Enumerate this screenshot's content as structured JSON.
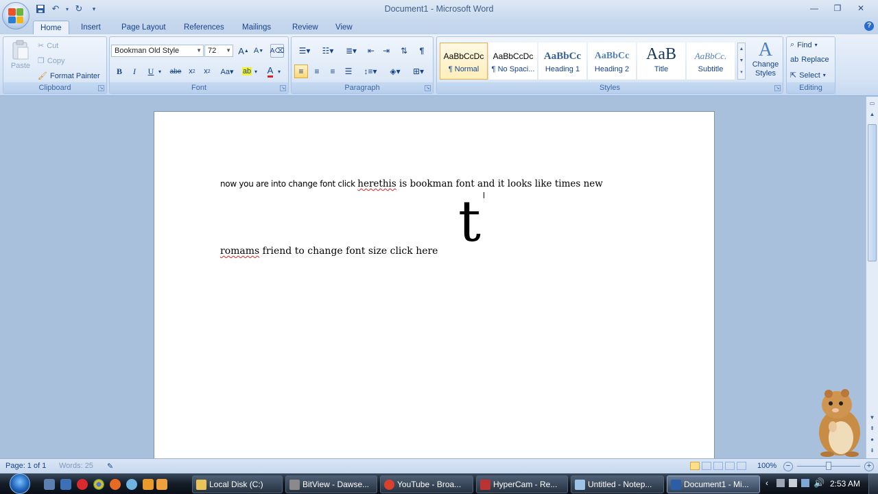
{
  "window": {
    "title": "Document1 - Microsoft Word"
  },
  "tabs": [
    "Home",
    "Insert",
    "Page Layout",
    "References",
    "Mailings",
    "Review",
    "View"
  ],
  "clipboard": {
    "label": "Clipboard",
    "paste": "Paste",
    "cut": "Cut",
    "copy": "Copy",
    "format_painter": "Format Painter"
  },
  "font": {
    "label": "Font",
    "name": "Bookman Old Style",
    "size": "72"
  },
  "paragraph": {
    "label": "Paragraph"
  },
  "styles": {
    "label": "Styles",
    "items": [
      {
        "sample": "AaBbCcDc",
        "name": "¶ Normal"
      },
      {
        "sample": "AaBbCcDc",
        "name": "¶ No Spaci..."
      },
      {
        "sample": "AaBbCс",
        "name": "Heading 1"
      },
      {
        "sample": "AaBbCc",
        "name": "Heading 2"
      },
      {
        "sample": "AaB",
        "name": "Title"
      },
      {
        "sample": "AaBbCc.",
        "name": "Subtitle"
      }
    ],
    "change_styles": "Change Styles"
  },
  "editing": {
    "label": "Editing",
    "find": "Find",
    "replace": "Replace",
    "select": "Select"
  },
  "document": {
    "line1_a": "now you are into change font click ",
    "line1_b": "herethis",
    "line1_c": " is bookman font and it looks like times new",
    "line2_a": "romams",
    "line2_b": " friend to change font size click here",
    "big_char": "t"
  },
  "status": {
    "page": "Page: 1 of 1",
    "words": "Words: 25",
    "zoom": "100%"
  },
  "taskbar": {
    "items": [
      {
        "label": "Local Disk (C:)",
        "color": "#e8c45a"
      },
      {
        "label": "BitView - Dawse...",
        "color": "#8a8a8a"
      },
      {
        "label": "YouTube - Broa...",
        "color": "#d9412f"
      },
      {
        "label": "HyperCam - Re...",
        "color": "#b33"
      },
      {
        "label": "Untitled - Notep...",
        "color": "#9fc3e8"
      },
      {
        "label": "Document1 - Mi...",
        "color": "#2c5ea8"
      }
    ],
    "clock": "2:53 AM"
  }
}
